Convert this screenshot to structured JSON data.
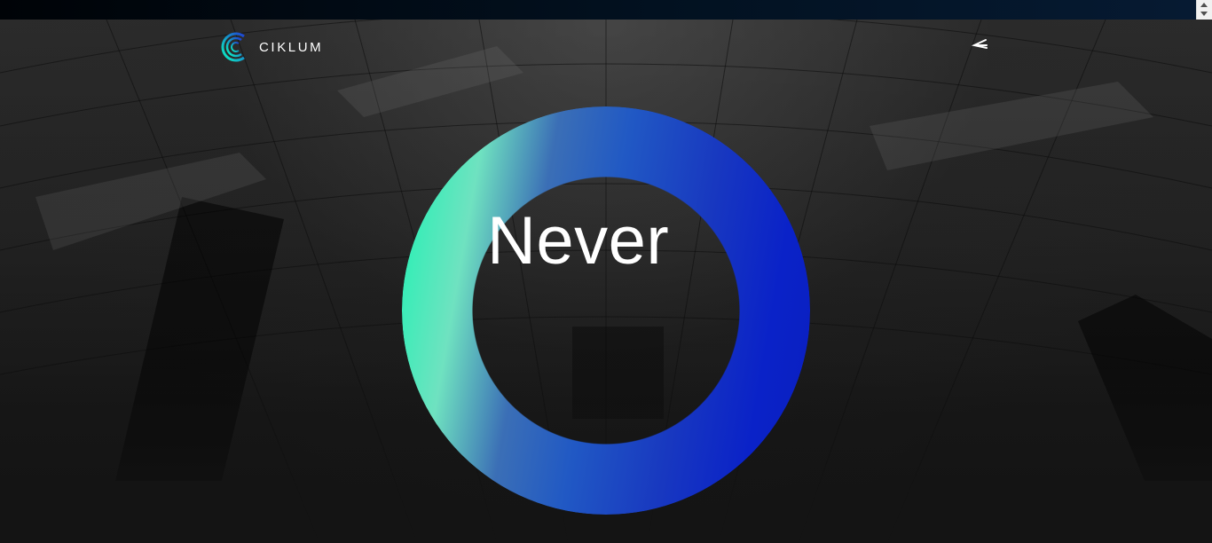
{
  "browser": {
    "scrollbar": {
      "up_icon": "scroll-up-arrow",
      "down_icon": "scroll-down-arrow"
    }
  },
  "header": {
    "logo_text": "CIKLUM",
    "logo_icon": "ciklum-c-logo",
    "menu_icon": "menu-arrow-icon"
  },
  "hero": {
    "headline": "Never",
    "ring_colors": [
      "#0bf7c0",
      "#6fe2c0",
      "#2159c4",
      "#0a22c8"
    ]
  },
  "colors": {
    "accent_green": "#0bf7c0",
    "accent_blue": "#0a22c8",
    "topbar": "#021120",
    "text": "#ffffff"
  }
}
